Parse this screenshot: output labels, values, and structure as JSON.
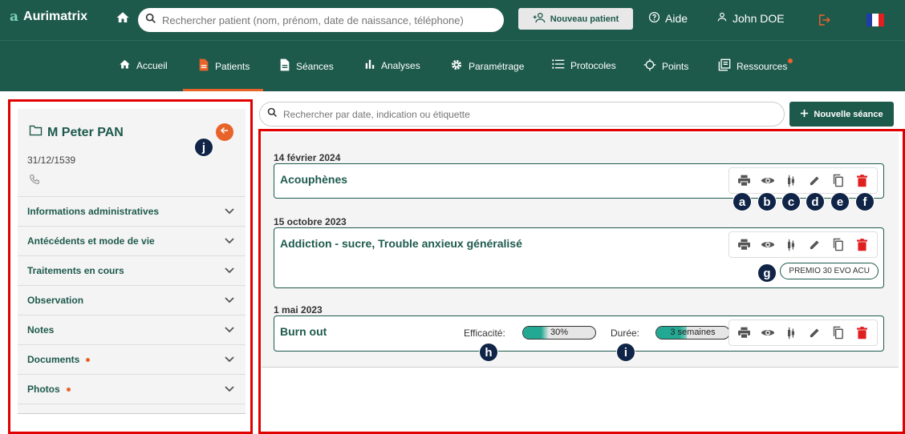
{
  "app": {
    "name": "Aurimatrix",
    "logo_mark": "a"
  },
  "header": {
    "search_placeholder": "Rechercher patient (nom, prénom, date de naissance, téléphone)",
    "new_patient_label": "Nouveau patient",
    "help_label": "Aide",
    "user_name": "John DOE"
  },
  "nav": {
    "items": [
      {
        "label": "Accueil",
        "icon": "home-icon"
      },
      {
        "label": "Patients",
        "icon": "document-icon"
      },
      {
        "label": "Séances",
        "icon": "file-icon"
      },
      {
        "label": "Analyses",
        "icon": "bar-chart-icon"
      },
      {
        "label": "Paramétrage",
        "icon": "gear-icon"
      },
      {
        "label": "Protocoles",
        "icon": "list-icon"
      },
      {
        "label": "Points",
        "icon": "crosshair-icon"
      },
      {
        "label": "Ressources",
        "icon": "library-icon"
      }
    ]
  },
  "patient": {
    "name": "M Peter PAN",
    "dob": "31/12/1539"
  },
  "sections": [
    {
      "label": "Informations administratives",
      "dot": false
    },
    {
      "label": "Antécédents et mode de vie",
      "dot": false
    },
    {
      "label": "Traitements en cours",
      "dot": false
    },
    {
      "label": "Observation",
      "dot": false
    },
    {
      "label": "Notes",
      "dot": false
    },
    {
      "label": "Documents",
      "dot": true
    },
    {
      "label": "Photos",
      "dot": true
    }
  ],
  "seances": {
    "search_placeholder": "Rechercher par date, indication ou étiquette",
    "new_label": "Nouvelle séance",
    "items": [
      {
        "date": "14 février 2024",
        "title": "Acouphènes"
      },
      {
        "date": "15 octobre 2023",
        "title": "Addiction - sucre, Trouble anxieux généralisé",
        "tag": "PREMIO 30 EVO ACU"
      },
      {
        "date": "1 mai 2023",
        "title": "Burn out",
        "efficacy_label": "Efficacité:",
        "efficacy_value": "30%",
        "duration_label": "Durée:",
        "duration_value": "3 semaines"
      }
    ]
  },
  "badges": {
    "a": "a",
    "b": "b",
    "c": "c",
    "d": "d",
    "e": "e",
    "f": "f",
    "g": "g",
    "h": "h",
    "i": "i",
    "j": "j"
  },
  "colors": {
    "primary": "#1e5a4c",
    "accent": "#e8632a",
    "danger": "#e02020",
    "highlight": "#e00000",
    "badge": "#0f2447"
  }
}
